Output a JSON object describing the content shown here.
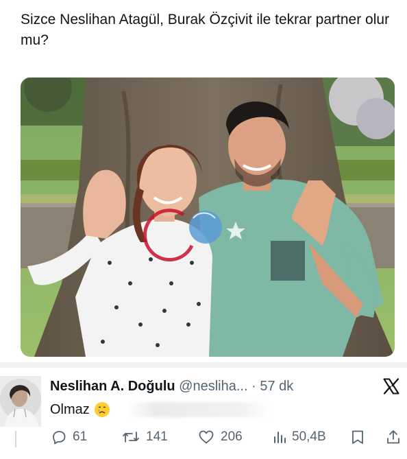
{
  "post": {
    "text": "Sizce Neslihan Atagül, Burak Özçivit ile tekrar partner olur mu?"
  },
  "reply": {
    "display_name": "Neslihan A. Doğulu",
    "handle": "@nesliha...",
    "separator": "·",
    "time": "57 dk",
    "text": "Olmaz",
    "emoji": "crying-face-emoji"
  },
  "actions": {
    "replies": "61",
    "reposts": "141",
    "likes": "206",
    "views": "50,4B"
  },
  "icons": {
    "brand": "x-logo-icon",
    "reply": "reply-icon",
    "repost": "repost-icon",
    "like": "heart-icon",
    "views": "views-icon",
    "bookmark": "bookmark-icon",
    "share": "share-icon"
  },
  "colors": {
    "text": "#0f1419",
    "secondary": "#536471",
    "background": "#ffffff"
  }
}
